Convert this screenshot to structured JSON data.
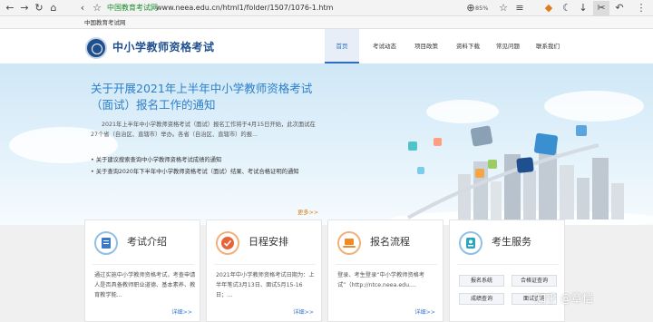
{
  "browser": {
    "site_label": "中国教育考试网",
    "url": "www.neea.edu.cn/html1/folder/1507/1076-1.htm",
    "zoom": "85%"
  },
  "favorites": [
    "中国教育考试网"
  ],
  "site": {
    "logo_text": "中小学教师资格考试",
    "nav": [
      "首页",
      "考试动态",
      "项目政策",
      "资料下载",
      "常见问题",
      "联系我们"
    ]
  },
  "banner": {
    "headline": "关于开展2021年上半年中小学教师资格考试（面试）报名工作的通知",
    "summary": "2021年上半年中小学教师资格考试（面试）报名工作将于4月15日开始，此次面试在27个省（自治区、直辖市）举办。各省（自治区、直辖市）的报...",
    "bullets": [
      "关于建议搜索查询中小学教师资格考试成绩的通知",
      "关于查询2020年下半年中小学教师资格考试（面试）结果、考试合格证明的通知"
    ],
    "more": "更多>>"
  },
  "cards": [
    {
      "title": "考试介绍",
      "body": "通过实施中小学教师资格考试，考查申请人是否具备教师职业道德、基本素养、教育教学能...",
      "more": "详细>>",
      "icon": "document-icon"
    },
    {
      "title": "日程安排",
      "body": "2021年中小学教师资格考试日期为：上半年笔试3月13日、面试5月15-16日；...",
      "more": "详细>>",
      "icon": "checkmark-icon"
    },
    {
      "title": "报名流程",
      "body": "登录、考生登录“中小学教师资格考试”（http://ntce.neea.edu....",
      "more": "详细>>",
      "icon": "laptop-icon"
    },
    {
      "title": "考生服务",
      "buttons": [
        "报名系统",
        "合格证查询",
        "成绩查询",
        "面试查询"
      ],
      "icon": "id-card-icon"
    }
  ],
  "watermark": "知乎 @章恺",
  "colors": {
    "accent": "#2c7fc9",
    "brand": "#1e4f8e",
    "more": "#d97e1b"
  }
}
